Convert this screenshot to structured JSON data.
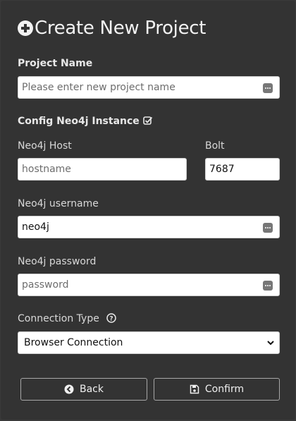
{
  "header": {
    "title": "Create New Project",
    "icon": "plus-circle-icon"
  },
  "project_name": {
    "label": "Project Name",
    "placeholder": "Please enter new project name",
    "value": ""
  },
  "config": {
    "label": "Config Neo4j Instance",
    "checked": true
  },
  "host": {
    "label": "Neo4j Host",
    "placeholder": "hostname",
    "value": ""
  },
  "bolt": {
    "label": "Bolt",
    "value": "7687"
  },
  "username": {
    "label": "Neo4j username",
    "value": "neo4j"
  },
  "password": {
    "label": "Neo4j password",
    "placeholder": "password",
    "value": ""
  },
  "connection_type": {
    "label": "Connection Type",
    "selected": "Browser Connection"
  },
  "buttons": {
    "back": "Back",
    "confirm": "Confirm"
  },
  "colors": {
    "background": "#333333",
    "text": "#e4e4e4",
    "field": "#ffffff"
  }
}
